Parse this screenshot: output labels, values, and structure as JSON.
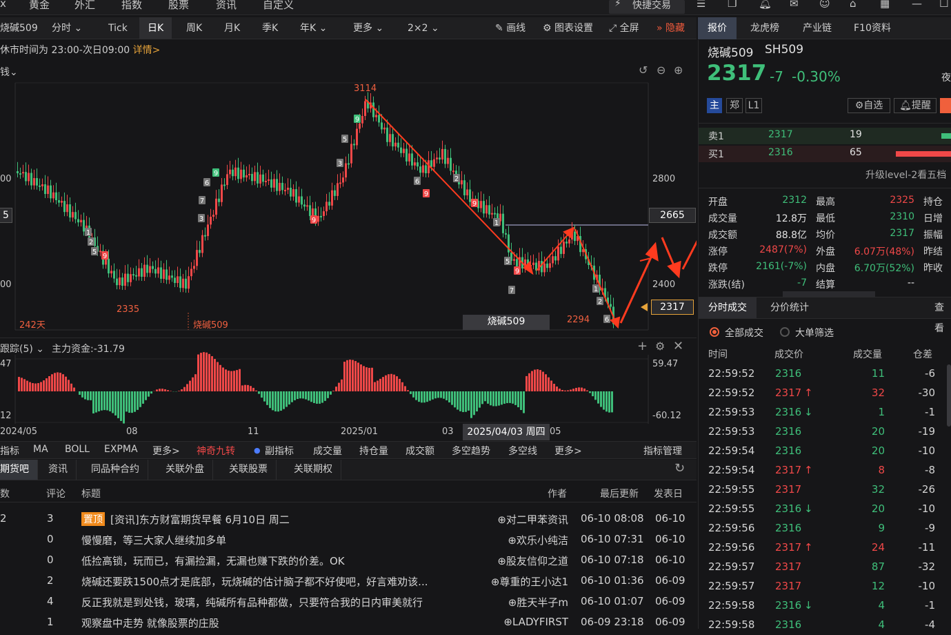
{
  "topnav": [
    "x",
    "黄金",
    "外汇",
    "指数",
    "股票",
    "资讯",
    "自定义"
  ],
  "topnav_btn": "快捷交易",
  "toolbar": {
    "symbol": "烧碱509",
    "periods": [
      "分时",
      "Tick",
      "日K",
      "周K",
      "月K",
      "季K",
      "年K",
      "更多",
      "2×2"
    ],
    "active_period": "日K",
    "draw": "画线",
    "chart_settings": "图表设置",
    "fullscreen": "全屏",
    "hide": "隐藏"
  },
  "notice": {
    "text": "休市时间为 23:00-次日09:00",
    "link": "详情>"
  },
  "main_chart": {
    "left_top_label": "钱",
    "y_ticks": [
      "2800",
      "2400"
    ],
    "left_y_ticks": [
      "00",
      "00"
    ],
    "left_box": "5",
    "price_box": "2665",
    "last_box": "2317",
    "high_label": "3114",
    "low_label": "2335",
    "low2_label": "2294",
    "days_label": "242天",
    "name_label": "烧碱509",
    "name_box": "烧碱509"
  },
  "sub_chart": {
    "title": "跟踪(5)",
    "fund_label": "主力资金:-31.79",
    "top_val": "59.47",
    "bottom_val": "-60.12",
    "left_top": "47",
    "left_bottom": "12"
  },
  "x_axis": {
    "ticks": [
      "2024/05",
      "08",
      "11",
      "2025/01",
      "03",
      "05"
    ],
    "cursor_date": "2025/04/03 周四"
  },
  "indicators": {
    "items": [
      "指标",
      "MA",
      "BOLL",
      "EXPMA",
      "更多>",
      "神奇九转",
      "副指标",
      "成交量",
      "持仓量",
      "成交额",
      "多空趋势",
      "多空线",
      "更多>"
    ],
    "manage": "指标管理"
  },
  "bottom_tabs": [
    "期货吧",
    "资讯",
    "同品种合约",
    "关联外盘",
    "关联股票",
    "关联期权"
  ],
  "forum": {
    "headers": {
      "reads": "数",
      "comments": "评论",
      "title": "标题",
      "author": "作者",
      "updated": "最后更新",
      "posted": "发表日"
    },
    "pinned": "置顶",
    "rows": [
      {
        "reads": "2",
        "comments": "3",
        "title": "[资讯]东方财富期货早餐 6月10日 周二",
        "author": "对二甲苯资讯",
        "updated": "06-10 08:08",
        "posted": "06-10"
      },
      {
        "reads": "",
        "comments": "0",
        "title": "慢慢磨，等三大家人继续加多单",
        "author": "欢乐小纯洁",
        "updated": "06-10 07:31",
        "posted": "06-10"
      },
      {
        "reads": "",
        "comments": "0",
        "title": "低捡高锁，玩而已，有漏捡漏，无漏也赚下跌的价差。OK",
        "author": "股友信仰之道",
        "updated": "06-10 07:18",
        "posted": "06-10"
      },
      {
        "reads": "",
        "comments": "2",
        "title": "烧碱还要跌1500点才是底部，玩烧碱的估计脑子都不好使吧，好言难劝该...",
        "author": "尊重的王小达1",
        "updated": "06-10 01:36",
        "posted": "06-09"
      },
      {
        "reads": "",
        "comments": "4",
        "title": "反正我就是到处钱，玻璃，纯碱所有品种都做，只要符合我的日内审美就行",
        "author": "胜天半子m",
        "updated": "06-10 01:07",
        "posted": "06-09"
      },
      {
        "reads": "",
        "comments": "1",
        "title": "观察盘中走势 就像股票的庄股",
        "author": "LADYFIRST",
        "updated": "06-09 23:18",
        "posted": "06-09"
      }
    ]
  },
  "right_tabs": [
    "报价",
    "龙虎榜",
    "产业链",
    "F10资料"
  ],
  "quote": {
    "name": "烧碱509",
    "code": "SH509",
    "price": "2317",
    "change": "-7",
    "pct": "-0.30%",
    "night": "夜",
    "tags": [
      "主",
      "郑",
      "L1"
    ],
    "watch": "自选",
    "alert": "提醒",
    "sell1": {
      "label": "卖1",
      "price": "2317",
      "vol": "19"
    },
    "buy1": {
      "label": "买1",
      "price": "2316",
      "vol": "65"
    },
    "upgrade": "升级level-2看五档",
    "stats": [
      {
        "k1": "开盘",
        "v1": "2312",
        "k2": "最高",
        "v2": "2325",
        "k3": "持仓"
      },
      {
        "k1": "成交量",
        "v1": "12.8万",
        "k2": "最低",
        "v2": "2310",
        "k3": "日增"
      },
      {
        "k1": "成交额",
        "v1": "88.8亿",
        "k2": "均价",
        "v2": "2317",
        "k3": "振幅"
      },
      {
        "k1": "涨停",
        "v1": "2487(7%)",
        "k2": "外盘",
        "v2": "6.07万(48%)",
        "k3": "昨结"
      },
      {
        "k1": "跌停",
        "v1": "2161(-7%)",
        "k2": "内盘",
        "v2": "6.70万(52%)",
        "k3": "昨收"
      },
      {
        "k1": "涨跌(结)",
        "v1": "-7",
        "k2": "结算",
        "v2": "--",
        "k3": ""
      }
    ]
  },
  "trades": {
    "tabs": [
      "分时成交",
      "分价统计"
    ],
    "more": "查看",
    "filters": [
      "全部成交",
      "大单筛选"
    ],
    "headers": [
      "时间",
      "成交价",
      "成交量",
      "仓差"
    ],
    "rows": [
      {
        "t": "22:59:52",
        "p": "2316",
        "d": "",
        "v": "11",
        "c": "-6"
      },
      {
        "t": "22:59:52",
        "p": "2317",
        "d": "↑",
        "v": "32",
        "c": "-30"
      },
      {
        "t": "22:59:53",
        "p": "2316",
        "d": "↓",
        "v": "1",
        "c": "-1"
      },
      {
        "t": "22:59:53",
        "p": "2316",
        "d": "",
        "v": "20",
        "c": "-19"
      },
      {
        "t": "22:59:54",
        "p": "2316",
        "d": "",
        "v": "20",
        "c": "-10"
      },
      {
        "t": "22:59:54",
        "p": "2317",
        "d": "↑",
        "v": "8",
        "c": "-8"
      },
      {
        "t": "22:59:55",
        "p": "2317",
        "d": "",
        "v": "32",
        "c": "-26"
      },
      {
        "t": "22:59:55",
        "p": "2316",
        "d": "↓",
        "v": "20",
        "c": "-10"
      },
      {
        "t": "22:59:56",
        "p": "2316",
        "d": "",
        "v": "9",
        "c": "-9"
      },
      {
        "t": "22:59:56",
        "p": "2317",
        "d": "↑",
        "v": "24",
        "c": "-11"
      },
      {
        "t": "22:59:57",
        "p": "2317",
        "d": "",
        "v": "87",
        "c": "-32"
      },
      {
        "t": "22:59:57",
        "p": "2317",
        "d": "",
        "v": "12",
        "c": "-10"
      },
      {
        "t": "22:59:58",
        "p": "2316",
        "d": "↓",
        "v": "4",
        "c": "-1"
      },
      {
        "t": "22:59:58",
        "p": "2316",
        "d": "",
        "v": "4",
        "c": "-4"
      }
    ]
  },
  "colors": {
    "up": "#f04848",
    "down": "#3fbf7a",
    "accent": "#e6a33a",
    "bg": "#161618"
  }
}
